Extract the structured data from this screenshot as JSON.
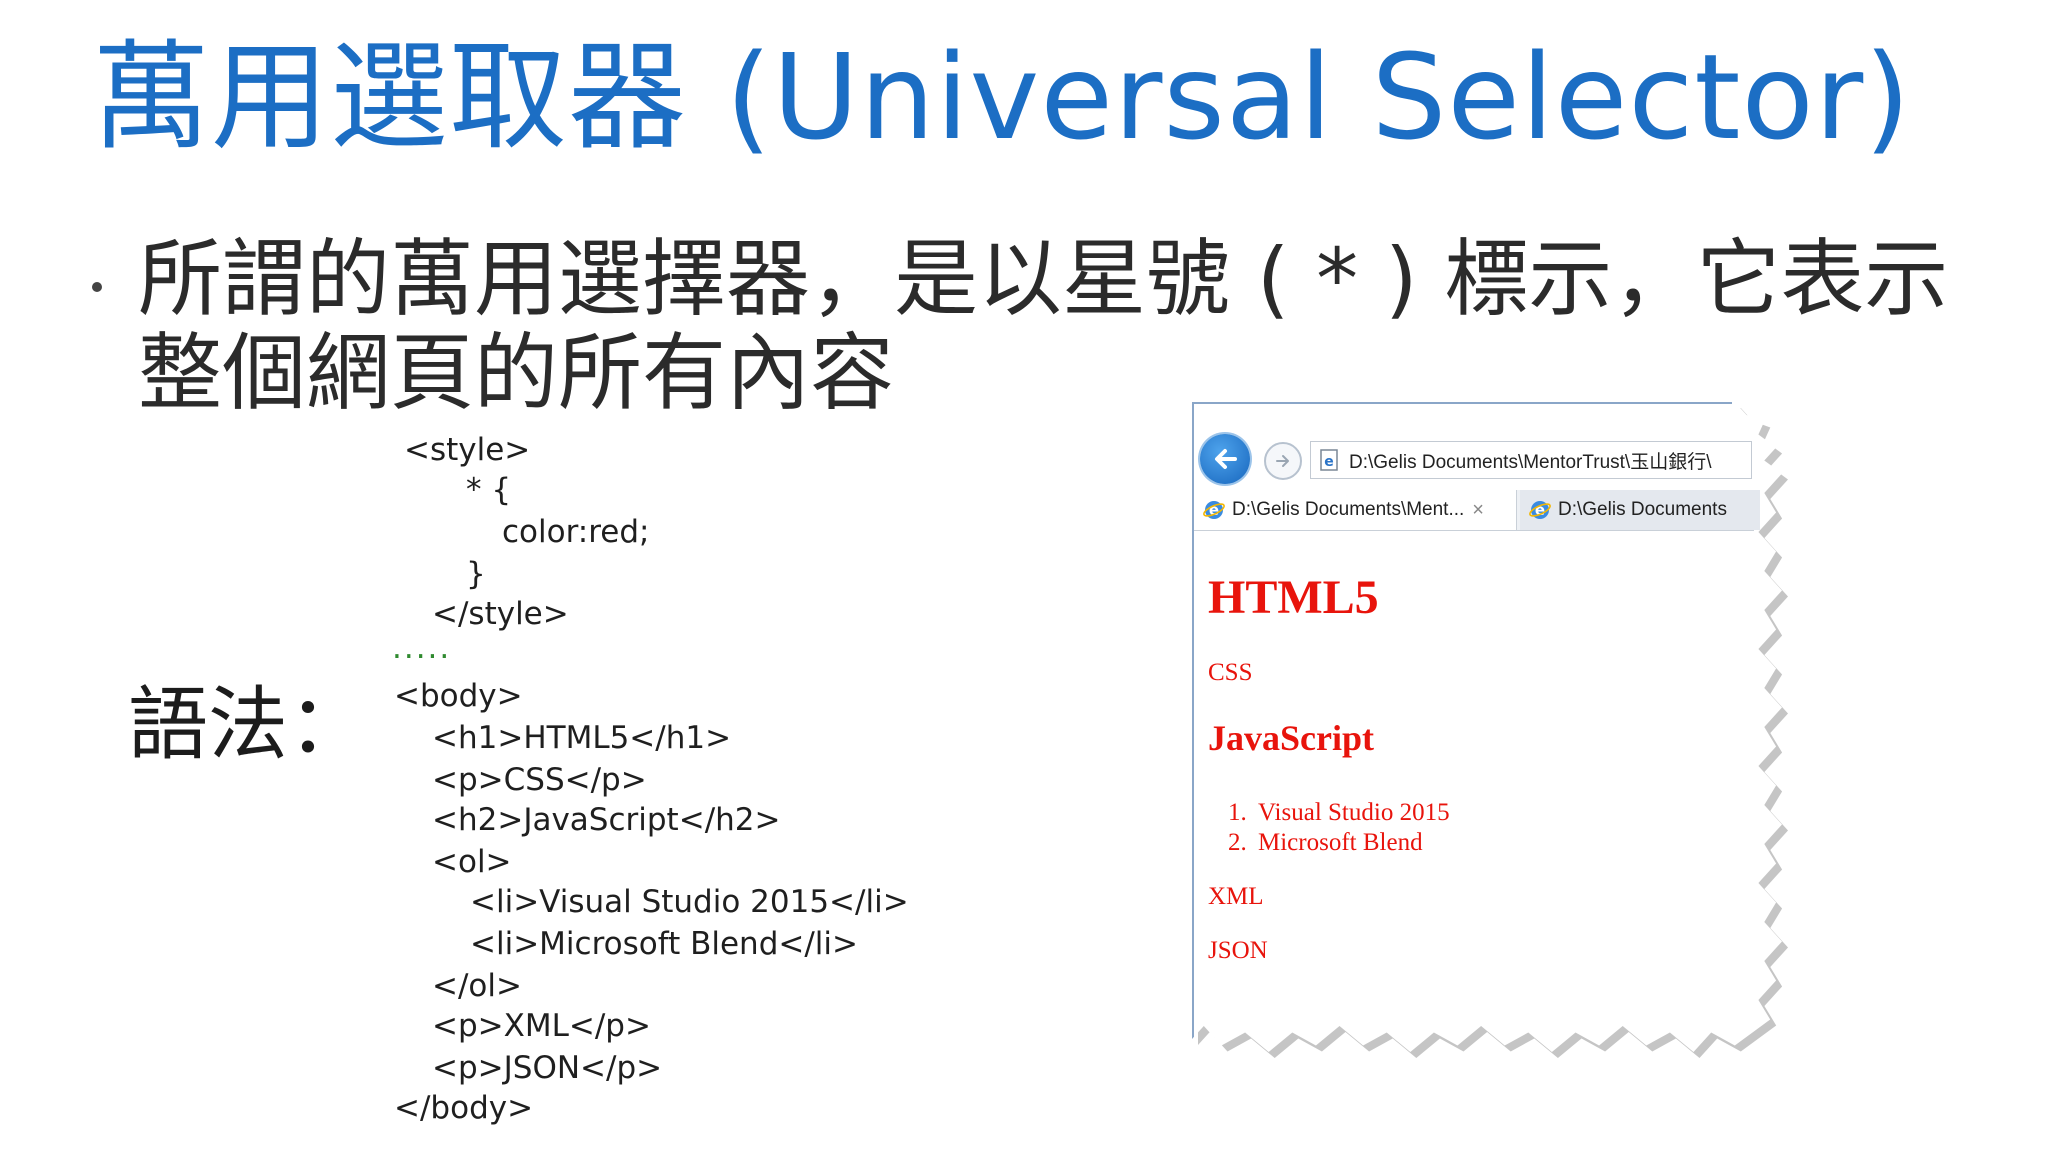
{
  "slide": {
    "title": "萬用選取器 (Universal Selector)",
    "bullet": "所謂的萬用選擇器，是以星號 ( * ) 標示，它表示整個網頁的所有內容",
    "syntax_label": "語法："
  },
  "code_lines": [
    "<style>",
    "* {",
    "color:red;",
    "}",
    "</style>",
    ".....",
    "<body>",
    "<h1>HTML5</h1>",
    "<p>CSS</p>",
    "<h2>JavaScript</h2>",
    "<ol>",
    "<li>Visual Studio 2015</li>",
    "<li>Microsoft Blend</li>",
    "</ol>",
    "<p>XML</p>",
    "<p>JSON</p>",
    "</body>"
  ],
  "browser": {
    "address": "D:\\Gelis Documents\\MentorTrust\\玉山銀行\\",
    "tabs": [
      {
        "label": "D:\\Gelis Documents\\Ment...",
        "close": "×"
      },
      {
        "label": "D:\\Gelis Documents"
      }
    ],
    "page": {
      "h1": "HTML5",
      "p_css": "CSS",
      "h2": "JavaScript",
      "list_items": [
        "Visual Studio 2015",
        "Microsoft Blend"
      ],
      "list_numbers": [
        "1.",
        "2."
      ],
      "p_xml": "XML",
      "p_json": "JSON"
    },
    "text_color": "#e8140c"
  },
  "colors": {
    "title": "#1c6ec4",
    "code_dots": "#2f8a2f"
  }
}
